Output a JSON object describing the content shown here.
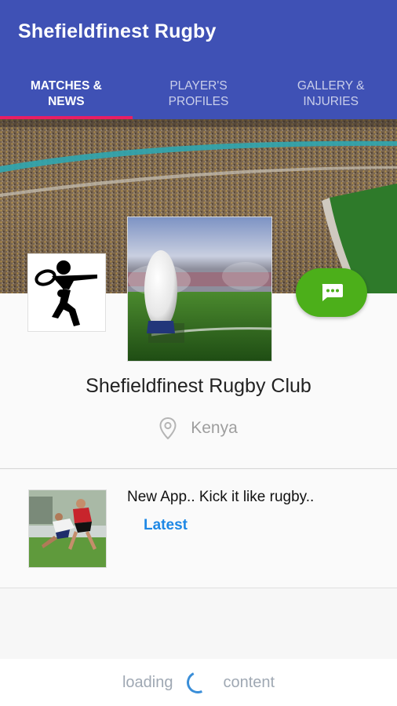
{
  "app": {
    "title": "Shefieldfinest Rugby"
  },
  "tabs": [
    {
      "line1": "MATCHES &",
      "line2": "NEWS",
      "active": true
    },
    {
      "line1": "PLAYER'S",
      "line2": "PROFILES",
      "active": false
    },
    {
      "line1": "GALLERY &",
      "line2": "INJURIES",
      "active": false
    }
  ],
  "profile": {
    "club_name": "Shefieldfinest Rugby Club",
    "location": "Kenya",
    "chat_icon": "chat-bubble-icon",
    "logo_icon": "rugby-player-logo",
    "photo": "rugby-ball-on-pitch"
  },
  "news": [
    {
      "title": "New App.. Kick it like rugby..",
      "tag": "Latest",
      "thumb": "rugby-players-tackle"
    }
  ],
  "footer": {
    "left_text": "loading",
    "right_text": "content"
  },
  "colors": {
    "primary": "#3f51b5",
    "tab_indicator": "#e91e63",
    "chat_button": "#4caf1a",
    "link": "#1e88e5"
  }
}
